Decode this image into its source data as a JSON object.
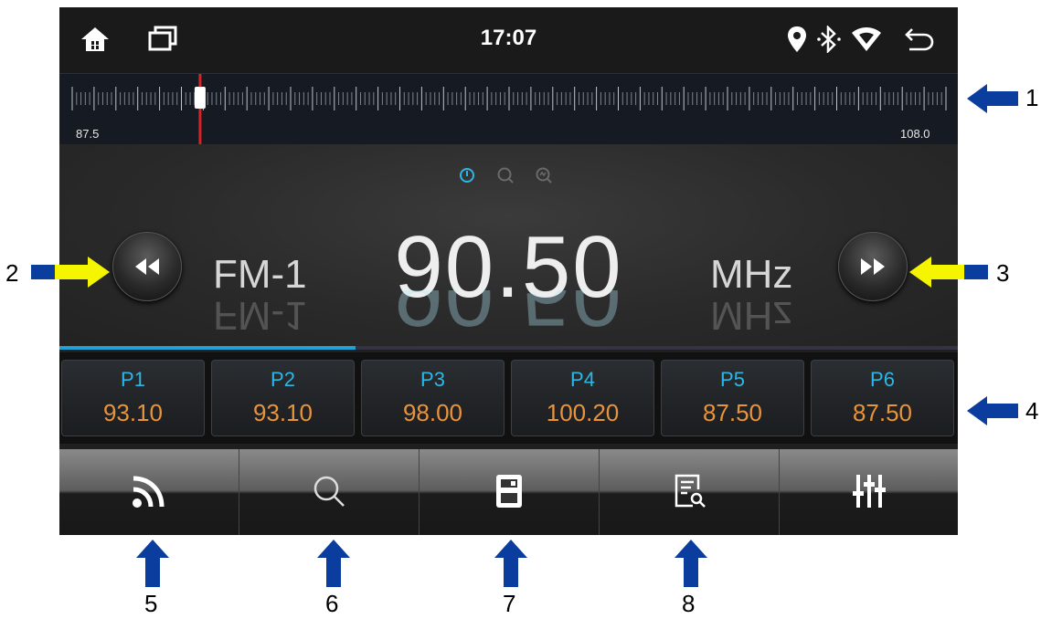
{
  "status_bar": {
    "time": "17:07",
    "icons": [
      "home-icon",
      "recent-apps-icon",
      "location-icon",
      "bluetooth-icon",
      "wifi-icon",
      "back-icon"
    ]
  },
  "tuner_scale": {
    "min_label": "87.5",
    "max_label": "108.0",
    "current_frequency_mhz": 90.5
  },
  "mode_icons": [
    "standby-icon",
    "scan-icon",
    "auto-search-icon"
  ],
  "display": {
    "band": "FM-1",
    "frequency": "90.50",
    "unit": "MHz",
    "progress_fraction": 0.33
  },
  "presets": [
    {
      "name": "P1",
      "freq": "93.10"
    },
    {
      "name": "P2",
      "freq": "93.10"
    },
    {
      "name": "P3",
      "freq": "98.00"
    },
    {
      "name": "P4",
      "freq": "100.20"
    },
    {
      "name": "P5",
      "freq": "87.50"
    },
    {
      "name": "P6",
      "freq": "87.50"
    }
  ],
  "toolbar": [
    "signal-icon",
    "search-icon",
    "save-icon",
    "list-search-icon",
    "equalizer-icon"
  ],
  "annotations": [
    "1",
    "2",
    "3",
    "4",
    "5",
    "6",
    "7",
    "8"
  ],
  "colors": {
    "accent_blue": "#2bb8e6",
    "preset_freq": "#e8943a",
    "needle": "#e02020",
    "annotation_arrow_blue": "#0a3d9e",
    "annotation_arrow_yellow": "#f5f500"
  }
}
